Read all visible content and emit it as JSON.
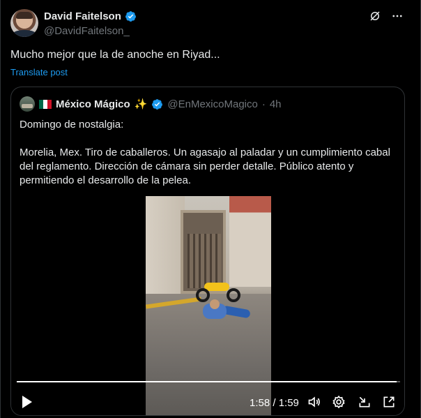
{
  "post": {
    "author": {
      "display_name": "David Faitelson",
      "handle": "@DavidFaitelson_",
      "verified": true,
      "avatar_icon": "profile-photo"
    },
    "text": "Mucho mejor que la de anoche en Riyad...",
    "translate_label": "Translate post",
    "top_icons": [
      "grok-icon",
      "more-icon"
    ]
  },
  "quote": {
    "author": {
      "flag": "mexico-flag",
      "display_name": "México Mágico",
      "emoji": "✨",
      "handle": "@EnMexicoMagico",
      "separator": "·",
      "time": "4h"
    },
    "paragraphs": [
      "Domingo de nostalgia:",
      "Morelia, Mex. Tiro de caballeros. Un agasajo al paladar y un cumplimiento cabal del reglamento. Dirección de cámara sin perder detalle. Público atento y permitiendo el desarrollo de la pelea."
    ]
  },
  "video": {
    "current_time": "1:58",
    "duration": "1:59",
    "time_text": "1:58 / 1:59",
    "progress": 0.99,
    "controls": [
      "play-icon",
      "volume-icon",
      "settings-icon",
      "exit-fullscreen-icon",
      "fullscreen-icon"
    ]
  },
  "colors": {
    "background": "#000000",
    "text": "#e7e9ea",
    "secondary_text": "#71767b",
    "accent": "#1d9bf0",
    "border": "#2f3336"
  }
}
